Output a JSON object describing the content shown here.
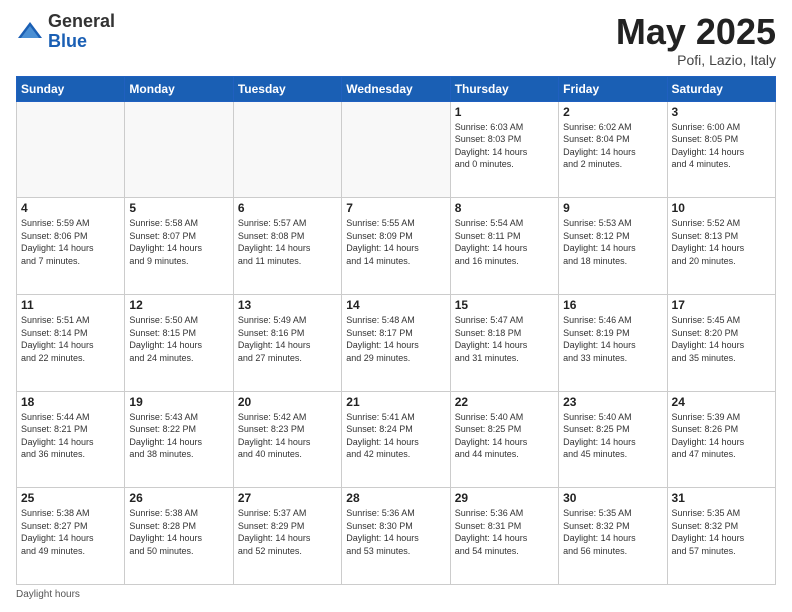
{
  "header": {
    "logo_general": "General",
    "logo_blue": "Blue",
    "month": "May 2025",
    "location": "Pofi, Lazio, Italy"
  },
  "days_of_week": [
    "Sunday",
    "Monday",
    "Tuesday",
    "Wednesday",
    "Thursday",
    "Friday",
    "Saturday"
  ],
  "footer_text": "Daylight hours",
  "weeks": [
    [
      {
        "num": "",
        "info": ""
      },
      {
        "num": "",
        "info": ""
      },
      {
        "num": "",
        "info": ""
      },
      {
        "num": "",
        "info": ""
      },
      {
        "num": "1",
        "info": "Sunrise: 6:03 AM\nSunset: 8:03 PM\nDaylight: 14 hours\nand 0 minutes."
      },
      {
        "num": "2",
        "info": "Sunrise: 6:02 AM\nSunset: 8:04 PM\nDaylight: 14 hours\nand 2 minutes."
      },
      {
        "num": "3",
        "info": "Sunrise: 6:00 AM\nSunset: 8:05 PM\nDaylight: 14 hours\nand 4 minutes."
      }
    ],
    [
      {
        "num": "4",
        "info": "Sunrise: 5:59 AM\nSunset: 8:06 PM\nDaylight: 14 hours\nand 7 minutes."
      },
      {
        "num": "5",
        "info": "Sunrise: 5:58 AM\nSunset: 8:07 PM\nDaylight: 14 hours\nand 9 minutes."
      },
      {
        "num": "6",
        "info": "Sunrise: 5:57 AM\nSunset: 8:08 PM\nDaylight: 14 hours\nand 11 minutes."
      },
      {
        "num": "7",
        "info": "Sunrise: 5:55 AM\nSunset: 8:09 PM\nDaylight: 14 hours\nand 14 minutes."
      },
      {
        "num": "8",
        "info": "Sunrise: 5:54 AM\nSunset: 8:11 PM\nDaylight: 14 hours\nand 16 minutes."
      },
      {
        "num": "9",
        "info": "Sunrise: 5:53 AM\nSunset: 8:12 PM\nDaylight: 14 hours\nand 18 minutes."
      },
      {
        "num": "10",
        "info": "Sunrise: 5:52 AM\nSunset: 8:13 PM\nDaylight: 14 hours\nand 20 minutes."
      }
    ],
    [
      {
        "num": "11",
        "info": "Sunrise: 5:51 AM\nSunset: 8:14 PM\nDaylight: 14 hours\nand 22 minutes."
      },
      {
        "num": "12",
        "info": "Sunrise: 5:50 AM\nSunset: 8:15 PM\nDaylight: 14 hours\nand 24 minutes."
      },
      {
        "num": "13",
        "info": "Sunrise: 5:49 AM\nSunset: 8:16 PM\nDaylight: 14 hours\nand 27 minutes."
      },
      {
        "num": "14",
        "info": "Sunrise: 5:48 AM\nSunset: 8:17 PM\nDaylight: 14 hours\nand 29 minutes."
      },
      {
        "num": "15",
        "info": "Sunrise: 5:47 AM\nSunset: 8:18 PM\nDaylight: 14 hours\nand 31 minutes."
      },
      {
        "num": "16",
        "info": "Sunrise: 5:46 AM\nSunset: 8:19 PM\nDaylight: 14 hours\nand 33 minutes."
      },
      {
        "num": "17",
        "info": "Sunrise: 5:45 AM\nSunset: 8:20 PM\nDaylight: 14 hours\nand 35 minutes."
      }
    ],
    [
      {
        "num": "18",
        "info": "Sunrise: 5:44 AM\nSunset: 8:21 PM\nDaylight: 14 hours\nand 36 minutes."
      },
      {
        "num": "19",
        "info": "Sunrise: 5:43 AM\nSunset: 8:22 PM\nDaylight: 14 hours\nand 38 minutes."
      },
      {
        "num": "20",
        "info": "Sunrise: 5:42 AM\nSunset: 8:23 PM\nDaylight: 14 hours\nand 40 minutes."
      },
      {
        "num": "21",
        "info": "Sunrise: 5:41 AM\nSunset: 8:24 PM\nDaylight: 14 hours\nand 42 minutes."
      },
      {
        "num": "22",
        "info": "Sunrise: 5:40 AM\nSunset: 8:25 PM\nDaylight: 14 hours\nand 44 minutes."
      },
      {
        "num": "23",
        "info": "Sunrise: 5:40 AM\nSunset: 8:25 PM\nDaylight: 14 hours\nand 45 minutes."
      },
      {
        "num": "24",
        "info": "Sunrise: 5:39 AM\nSunset: 8:26 PM\nDaylight: 14 hours\nand 47 minutes."
      }
    ],
    [
      {
        "num": "25",
        "info": "Sunrise: 5:38 AM\nSunset: 8:27 PM\nDaylight: 14 hours\nand 49 minutes."
      },
      {
        "num": "26",
        "info": "Sunrise: 5:38 AM\nSunset: 8:28 PM\nDaylight: 14 hours\nand 50 minutes."
      },
      {
        "num": "27",
        "info": "Sunrise: 5:37 AM\nSunset: 8:29 PM\nDaylight: 14 hours\nand 52 minutes."
      },
      {
        "num": "28",
        "info": "Sunrise: 5:36 AM\nSunset: 8:30 PM\nDaylight: 14 hours\nand 53 minutes."
      },
      {
        "num": "29",
        "info": "Sunrise: 5:36 AM\nSunset: 8:31 PM\nDaylight: 14 hours\nand 54 minutes."
      },
      {
        "num": "30",
        "info": "Sunrise: 5:35 AM\nSunset: 8:32 PM\nDaylight: 14 hours\nand 56 minutes."
      },
      {
        "num": "31",
        "info": "Sunrise: 5:35 AM\nSunset: 8:32 PM\nDaylight: 14 hours\nand 57 minutes."
      }
    ]
  ]
}
